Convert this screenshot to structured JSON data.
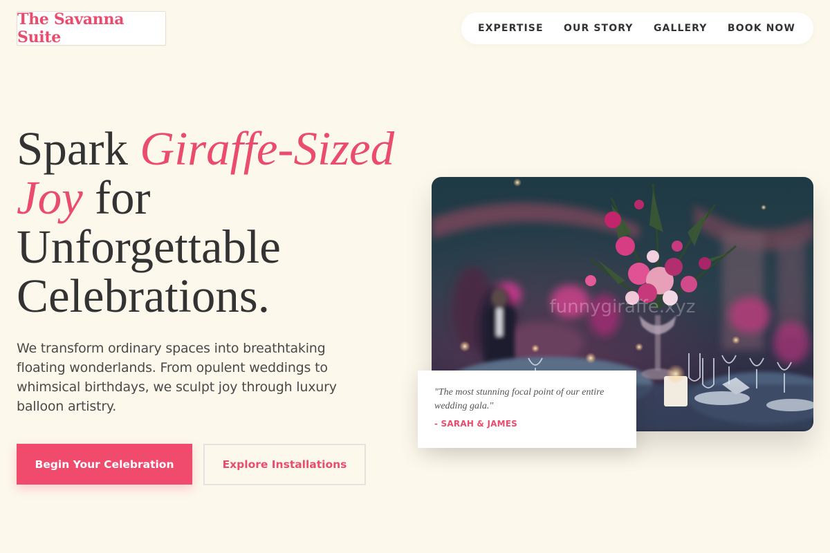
{
  "header": {
    "logo": "The Savanna Suite",
    "nav": [
      "EXPERTISE",
      "OUR STORY",
      "GALLERY",
      "BOOK NOW"
    ]
  },
  "hero": {
    "title_start": "Spark ",
    "title_accent": "Giraffe-Sized Joy",
    "title_end": " for Unforgettable Celebrations.",
    "description": "We transform ordinary spaces into breathtaking floating wonderlands. From opulent weddings to whimsical birthdays, we sculpt joy through luxury balloon artistry.",
    "primary_button": "Begin Your Celebration",
    "secondary_button": "Explore Installations"
  },
  "image": {
    "watermark": "funnygiraffe.xyz"
  },
  "testimonial": {
    "quote": "\"The most stunning focal point of our entire wedding gala.\"",
    "author": "- SARAH & JAMES"
  },
  "colors": {
    "background": "#fdf8ec",
    "accent": "#ea4c6d",
    "text": "#333333"
  }
}
